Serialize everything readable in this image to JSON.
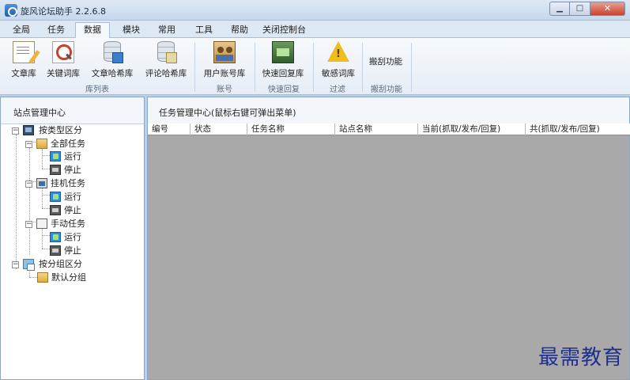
{
  "window": {
    "title": "旋风论坛助手 2.2.6.8"
  },
  "menu": {
    "tabs": [
      "全局",
      "任务",
      "数据",
      "模块",
      "常用",
      "工具",
      "帮助",
      "关闭控制台"
    ],
    "active_tab": "数据"
  },
  "ribbon": {
    "buttons": [
      {
        "label": "文章库",
        "icon": "document-icon"
      },
      {
        "label": "关键词库",
        "icon": "magnifier-icon"
      },
      {
        "label": "文章哈希库",
        "icon": "database-icon"
      },
      {
        "label": "评论哈希库",
        "icon": "database-icon"
      },
      {
        "label": "用户账号库",
        "icon": "users-icon"
      },
      {
        "label": "快速回复库",
        "icon": "reply-icon"
      },
      {
        "label": "敏感词库",
        "icon": "warning-icon"
      },
      {
        "label": "搬刮功能",
        "icon": ""
      }
    ],
    "groups": [
      "库列表",
      "账号",
      "快速回复",
      "过滤",
      "搬刮功能"
    ]
  },
  "left_panel": {
    "title": "站点管理中心",
    "tree": [
      {
        "label": "按类型区分",
        "level": 0,
        "icon": "computer-icon",
        "expander": "−"
      },
      {
        "label": "全部任务",
        "level": 1,
        "icon": "folder-icon",
        "expander": "−"
      },
      {
        "label": "运行",
        "level": 2,
        "icon": "run-icon"
      },
      {
        "label": "停止",
        "level": 2,
        "icon": "stop-icon"
      },
      {
        "label": "挂机任务",
        "level": 1,
        "icon": "robot-icon",
        "expander": "−"
      },
      {
        "label": "运行",
        "level": 2,
        "icon": "run-icon"
      },
      {
        "label": "停止",
        "level": 2,
        "icon": "stop-icon"
      },
      {
        "label": "手动任务",
        "level": 1,
        "icon": "hand-icon",
        "expander": "−"
      },
      {
        "label": "运行",
        "level": 2,
        "icon": "run-icon"
      },
      {
        "label": "停止",
        "level": 2,
        "icon": "stop-icon"
      },
      {
        "label": "按分组区分",
        "level": 0,
        "icon": "group-icon",
        "expander": "−"
      },
      {
        "label": "默认分组",
        "level": 1,
        "icon": "group-icon"
      }
    ]
  },
  "right_panel": {
    "title": "任务管理中心(鼠标右键可弹出菜单)",
    "columns": [
      "编号",
      "状态",
      "任务名称",
      "站点名称",
      "当前(抓取/发布/回复)",
      "共(抓取/发布/回复)"
    ]
  },
  "watermark": "最需教育"
}
